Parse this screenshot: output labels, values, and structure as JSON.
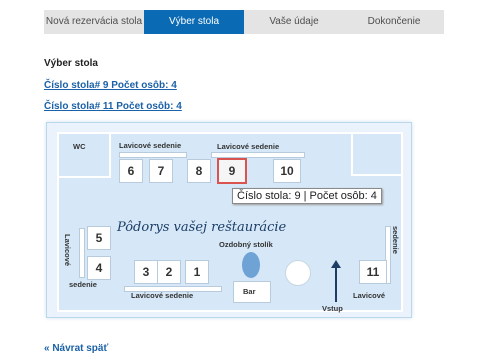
{
  "tabs": [
    {
      "label": "Nová rezervácia stola",
      "active": false
    },
    {
      "label": "Výber stola",
      "active": true
    },
    {
      "label": "Vaše údaje",
      "active": false
    },
    {
      "label": "Dokončenie",
      "active": false
    }
  ],
  "section_title": "Výber stola",
  "selected_tables": [
    {
      "label": "Číslo stola# 9 Počet osôb: 4"
    },
    {
      "label": "Číslo stola# 11 Počet osôb: 4"
    }
  ],
  "plan": {
    "title": "Pôdorys vašej reštaurácie",
    "labels": {
      "wc": "WC",
      "bench_top_left": "Lavicové sedenie",
      "bench_top_right": "Lavicové sedenie",
      "bench_left": "Lavicové",
      "bench_left_bottom": "sedenie",
      "bench_bottom": "Lavicové sedenie",
      "bench_right_bottom": "Lavicové",
      "bench_right_vertical": "sedenie",
      "decor_table": "Ozdobný stolík",
      "bar": "Bar",
      "entrance": "Vstup"
    },
    "tables": {
      "t6": "6",
      "t7": "7",
      "t8": "8",
      "t9": "9",
      "t10": "10",
      "t5": "5",
      "t4": "4",
      "t3": "3",
      "t2": "2",
      "t1": "1",
      "t11": "11"
    },
    "tooltip": "Číslo stola: 9 | Počet osôb: 4"
  },
  "back_link": "« Návrat späť"
}
